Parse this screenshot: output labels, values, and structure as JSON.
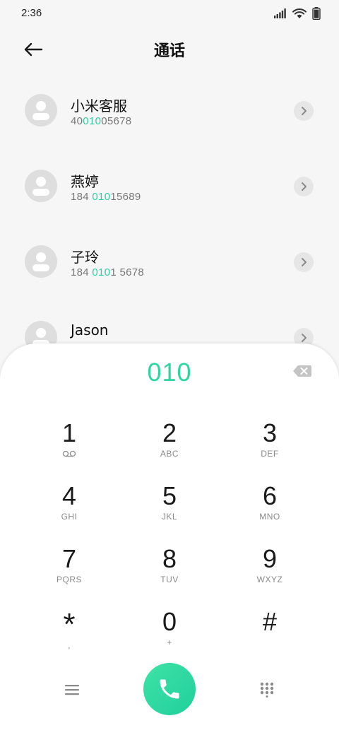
{
  "status_bar": {
    "time": "2:36",
    "icons": [
      "signal-icon",
      "wifi-icon",
      "battery-icon"
    ]
  },
  "header": {
    "title": "通话",
    "back_icon": "arrow-left-icon"
  },
  "contacts": [
    {
      "name": "小米客服",
      "number_pre": "40",
      "number_match": "010",
      "number_post": "05678"
    },
    {
      "name": "燕婷",
      "number_pre": "184 ",
      "number_match": "010",
      "number_post": "15689"
    },
    {
      "name": "子玲",
      "number_pre": "184 ",
      "number_match": "010",
      "number_post": "1 5678"
    },
    {
      "name": "Jason",
      "number_pre": "",
      "number_match": "",
      "number_post": ""
    }
  ],
  "dialpad": {
    "display": "010",
    "keys": [
      {
        "digit": "1",
        "letters": ""
      },
      {
        "digit": "2",
        "letters": "ABC"
      },
      {
        "digit": "3",
        "letters": "DEF"
      },
      {
        "digit": "4",
        "letters": "GHI"
      },
      {
        "digit": "5",
        "letters": "JKL"
      },
      {
        "digit": "6",
        "letters": "MNO"
      },
      {
        "digit": "7",
        "letters": "PQRS"
      },
      {
        "digit": "8",
        "letters": "TUV"
      },
      {
        "digit": "9",
        "letters": "WXYZ"
      },
      {
        "digit": "*",
        "letters": ","
      },
      {
        "digit": "0",
        "letters": "+"
      },
      {
        "digit": "#",
        "letters": ""
      }
    ]
  },
  "colors": {
    "accent": "#2ed69c",
    "match_highlight": "#2ecfa0",
    "call_button": "#2ad9a0"
  }
}
